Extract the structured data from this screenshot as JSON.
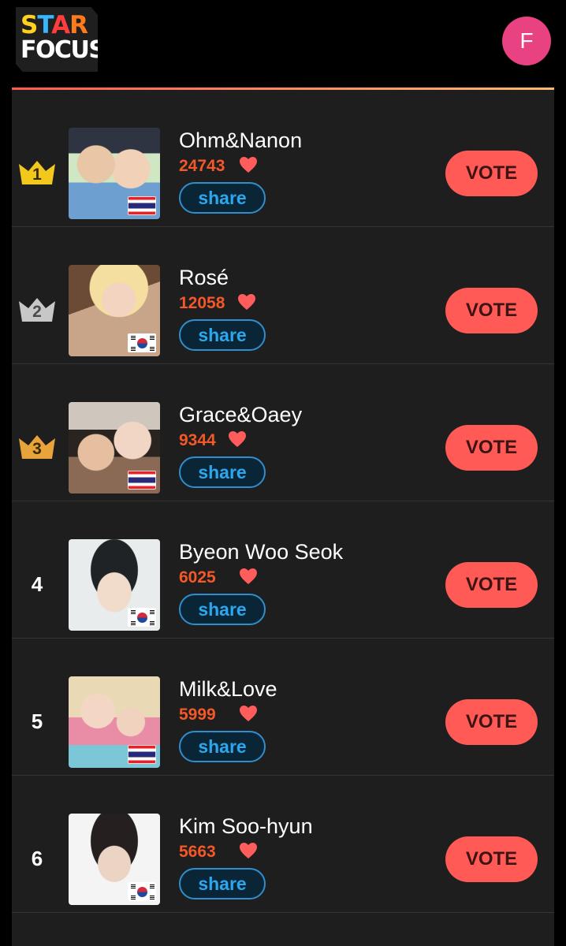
{
  "header": {
    "logo_star": [
      "S",
      "T",
      "A",
      "R"
    ],
    "logo_focus": "FOCUS",
    "avatar_initial": "F"
  },
  "ranking": [
    {
      "rank": "1",
      "name": "Ohm&Nanon",
      "score": "24743",
      "share_label": "share",
      "vote_label": "VOTE",
      "flag": "thailand",
      "crown": "gold"
    },
    {
      "rank": "2",
      "name": "Rosé",
      "score": "12058",
      "share_label": "share",
      "vote_label": "VOTE",
      "flag": "korea",
      "crown": "silver"
    },
    {
      "rank": "3",
      "name": "Grace&Oaey",
      "score": "9344",
      "share_label": "share",
      "vote_label": "VOTE",
      "flag": "thailand",
      "crown": "bronze"
    },
    {
      "rank": "4",
      "name": "Byeon Woo Seok",
      "score": "6025",
      "share_label": "share",
      "vote_label": "VOTE",
      "flag": "korea",
      "crown": ""
    },
    {
      "rank": "5",
      "name": "Milk&Love",
      "score": "5999",
      "share_label": "share",
      "vote_label": "VOTE",
      "flag": "thailand",
      "crown": ""
    },
    {
      "rank": "6",
      "name": "Kim Soo-hyun",
      "score": "5663",
      "share_label": "share",
      "vote_label": "VOTE",
      "flag": "korea",
      "crown": ""
    }
  ],
  "colors": {
    "accent_vote": "#ff5a55",
    "score_orange": "#f45828",
    "share_blue": "#2ba7ef",
    "avatar_pink": "#e84282",
    "crown_gold": "#f2c81c",
    "crown_silver": "#c7c7c7",
    "crown_bronze": "#e8a33a"
  }
}
